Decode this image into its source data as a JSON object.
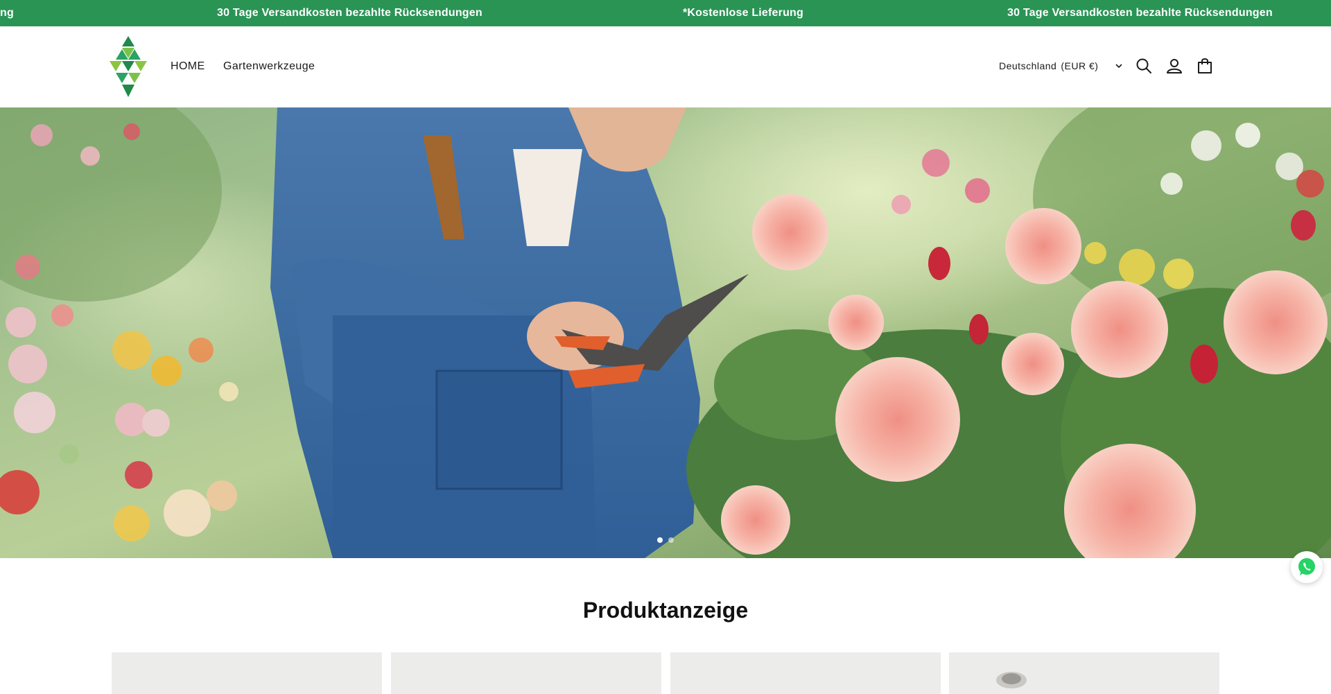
{
  "announcement": {
    "messages": [
      "ng",
      "30 Tage Versandkosten bezahlte Rücksendungen",
      "*Kostenlose Lieferung",
      "30 Tage Versandkosten bezahlte Rücksendungen"
    ],
    "background": "#2a9455"
  },
  "header": {
    "nav": [
      {
        "label": "HOME"
      },
      {
        "label": "Gartenwerkzeuge"
      }
    ],
    "locale": {
      "country": "Deutschland",
      "currency": "(EUR €)"
    },
    "icons": [
      "logo-icon",
      "chevron-down-icon",
      "search-icon",
      "account-icon",
      "cart-icon"
    ]
  },
  "hero": {
    "slides_count": 2,
    "active_slide": 1
  },
  "products": {
    "title": "Produktanzeige",
    "cards_visible": 4
  },
  "colors": {
    "accent": "#2a9455",
    "whatsapp": "#25d366",
    "card_bg": "#ececea"
  }
}
